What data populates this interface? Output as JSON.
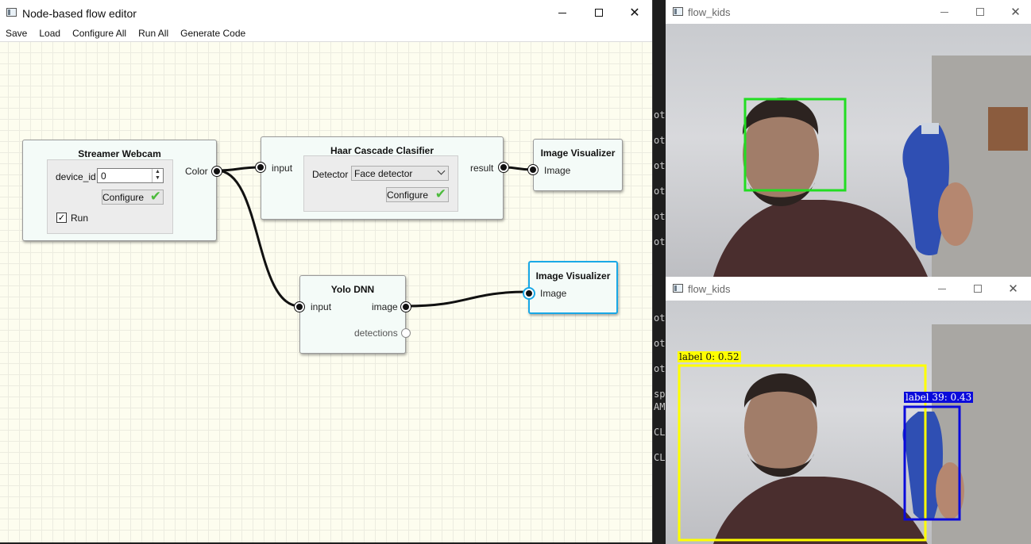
{
  "editor": {
    "title": "Node-based flow editor",
    "menu": [
      "Save",
      "Load",
      "Configure All",
      "Run All",
      "Generate Code"
    ],
    "nodes": {
      "streamer": {
        "title": "Streamer Webcam",
        "device_label": "device_id",
        "device_value": "0",
        "configure_label": "Configure",
        "run_label": "Run",
        "run_checked": true,
        "output_port": "Color"
      },
      "haar": {
        "title": "Haar Cascade Clasifier",
        "input_port": "input",
        "detector_label": "Detector",
        "detector_value": "Face detector",
        "configure_label": "Configure",
        "output_port": "result"
      },
      "viz1": {
        "title": "Image Visualizer",
        "input_port": "Image"
      },
      "yolo": {
        "title": "Yolo DNN",
        "input_port": "input",
        "output_image": "image",
        "output_detections": "detections"
      },
      "viz2": {
        "title": "Image Visualizer",
        "input_port": "Image"
      }
    }
  },
  "camera_windows": [
    {
      "title": "flow_kids",
      "box_color": "#22dd22"
    },
    {
      "title": "flow_kids",
      "detections": [
        {
          "label": "label 0: 0.52",
          "color": "#ffff00",
          "text_color": "#111111"
        },
        {
          "label": "label 39: 0.43",
          "color": "#0a0adb",
          "text_color": "#ffffff"
        }
      ]
    }
  ],
  "terminal_lines": [
    "ot(",
    "ot(",
    "ot(",
    "ot(",
    "ot(",
    "ot(",
    "ot(",
    "ot(",
    "ot(",
    "ot(",
    "spa",
    "AME",
    "CL",
    "CL"
  ],
  "colors": {
    "selected": "#19a8e6",
    "canvas": "#fdfdef",
    "check": "#4cbb3c"
  }
}
